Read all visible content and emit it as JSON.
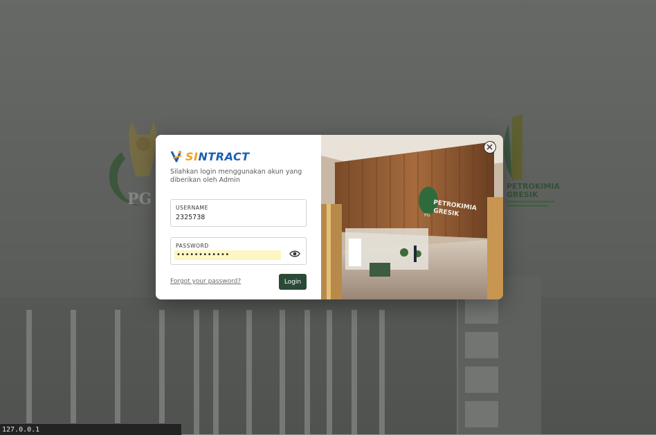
{
  "brand": {
    "name_prefix": "SI",
    "name_suffix": "NTRACT"
  },
  "login": {
    "subtitle": "Silahkan login menggunakan akun yang diberikan oleh Admin",
    "username_label": "USERNAME",
    "username_value": "2325738",
    "password_label": "PASSWORD",
    "password_mask": "••••••••••••",
    "forgot_link": "Forgot your password?",
    "login_button": "Login"
  },
  "background": {
    "right_logo_line1": "PETROKIMIA",
    "right_logo_line2": "GRESIK",
    "left_logo_text": "PG"
  },
  "hero_image": {
    "sign_line1": "PETROKIMIA",
    "sign_line2": "GRESIK",
    "badge": "PG"
  },
  "status_bar": {
    "url": "127.0.0.1"
  },
  "colors": {
    "primary_button": "#2b4a36",
    "brand_blue": "#1b5fb3",
    "brand_orange": "#f0a020",
    "autofill": "#fdf6c3"
  },
  "icons": {
    "close": "close-circle-icon",
    "password_toggle": "eye-icon",
    "brand": "sintract-logo-icon"
  }
}
